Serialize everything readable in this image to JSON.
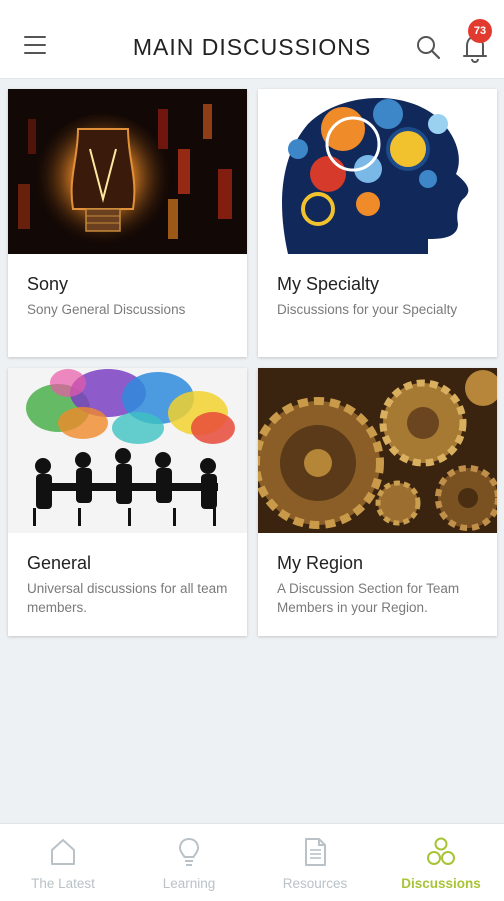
{
  "header": {
    "title": "MAIN DISCUSSIONS",
    "notification_count": "73",
    "icons": [
      "menu-icon",
      "search-icon",
      "bell-icon"
    ]
  },
  "cards": [
    {
      "title": "Sony",
      "description": "Sony General Discussions",
      "image": "lightbulb-image"
    },
    {
      "title": "My Specialty",
      "description": "Discussions for your Specialty",
      "image": "gears-head-image"
    },
    {
      "title": "General",
      "description": "Universal discussions for all team members.",
      "image": "meeting-speech-bubbles-image"
    },
    {
      "title": "My Region",
      "description": "A Discussion Section for Team Members in your Region.",
      "image": "brass-gears-image"
    }
  ],
  "bottom_nav": {
    "items": [
      {
        "label": "The Latest",
        "icon": "home-icon",
        "active": false
      },
      {
        "label": "Learning",
        "icon": "lightbulb-icon",
        "active": false
      },
      {
        "label": "Resources",
        "icon": "document-icon",
        "active": false
      },
      {
        "label": "Discussions",
        "icon": "discussions-icon",
        "active": true
      }
    ],
    "active_color": "#a7c437",
    "inactive_color": "#b9c2c6"
  },
  "colors": {
    "badge": "#e33a2f",
    "background": "#eef1f3"
  }
}
